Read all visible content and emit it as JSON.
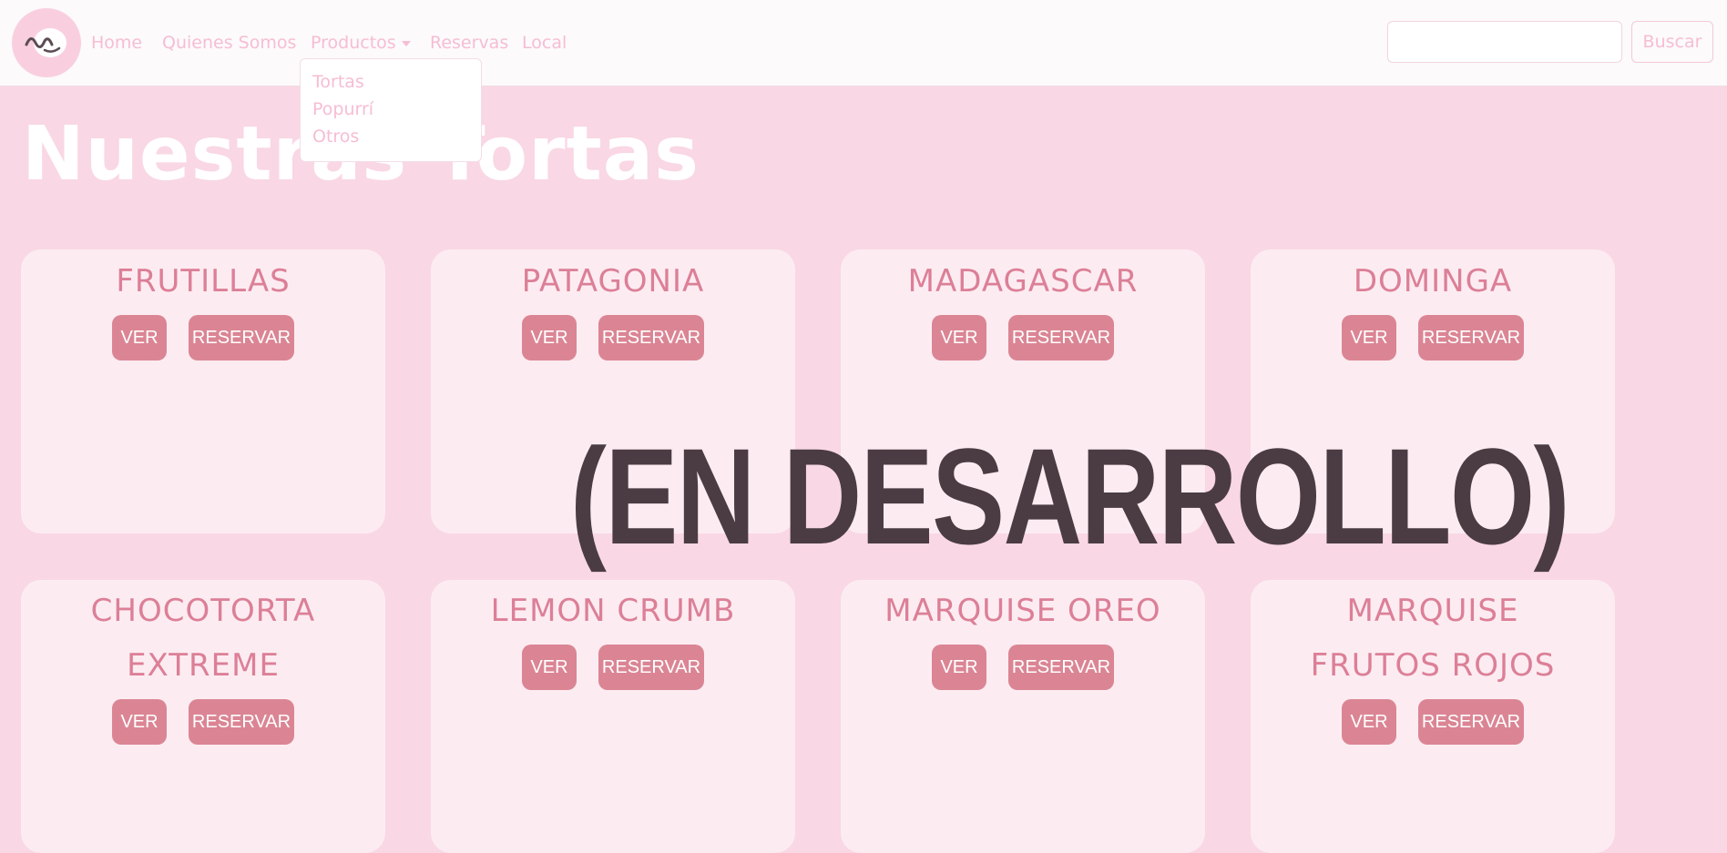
{
  "nav": {
    "logo": "ondas-logo-icon",
    "links": [
      "Home",
      "Quienes Somos",
      "Productos",
      "Reservas",
      "Local"
    ],
    "dropdown": [
      "Tortas",
      "Popurrí",
      "Otros"
    ],
    "search": {
      "value": "",
      "placeholder": ""
    },
    "search_button": "Buscar"
  },
  "page": {
    "title": "Nuestras Tortas",
    "overlay": "(EN DESARROLLO)"
  },
  "products": [
    {
      "name": [
        "FRUTILLAS"
      ],
      "ver": "VER",
      "reservar": "RESERVAR"
    },
    {
      "name": [
        "PATAGONIA"
      ],
      "ver": "VER",
      "reservar": "RESERVAR"
    },
    {
      "name": [
        "MADAGASCAR"
      ],
      "ver": "VER",
      "reservar": "RESERVAR"
    },
    {
      "name": [
        "DOMINGA"
      ],
      "ver": "VER",
      "reservar": "RESERVAR"
    },
    {
      "name": [
        "CHOCOTORTA",
        "EXTREME"
      ],
      "ver": "VER",
      "reservar": "RESERVAR"
    },
    {
      "name": [
        "LEMON CRUMB"
      ],
      "ver": "VER",
      "reservar": "RESERVAR"
    },
    {
      "name": [
        "MARQUISE OREO"
      ],
      "ver": "VER",
      "reservar": "RESERVAR"
    },
    {
      "name": [
        "MARQUISE",
        "FRUTOS ROJOS"
      ],
      "ver": "VER",
      "reservar": "RESERVAR"
    }
  ],
  "colors": {
    "background": "#f9d7e4",
    "navbar": "#fcfafb",
    "card": "#fcecf2",
    "accent": "#db8594",
    "title_pink": "#dc7f97",
    "nav_text": "#f6bdd3",
    "overlay_text": "#4a3c42"
  }
}
